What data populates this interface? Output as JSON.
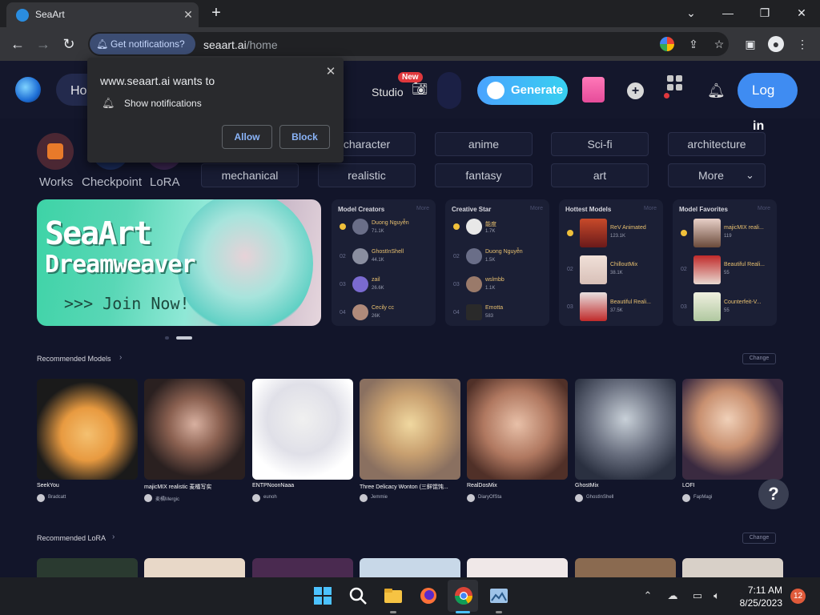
{
  "browser": {
    "tab_title": "SeaArt",
    "tab_close": "✕",
    "new_tab": "+",
    "window_controls": [
      "⌄",
      "—",
      "❐",
      "✕"
    ],
    "notif_chip": "Get notifications?",
    "url_host": "seaart.ai",
    "url_path": "/home"
  },
  "popup": {
    "title": "www.seaart.ai wants to",
    "permission": "Show notifications",
    "allow": "Allow",
    "block": "Block",
    "close": "✕"
  },
  "header": {
    "home_label": "Ho",
    "studio_label": "Studio",
    "new_badge": "New",
    "generate_label": "Generate",
    "login_label": "Log",
    "login_label_wrap": "in"
  },
  "categories": {
    "works": "Works",
    "checkpoint": "Checkpoint",
    "lora": "LoRA"
  },
  "tags": {
    "row1": [
      "character",
      "anime",
      "Sci-fi",
      "architecture"
    ],
    "row2": [
      "mechanical",
      "realistic",
      "fantasy",
      "art"
    ],
    "more": "More"
  },
  "banner": {
    "line1": "SeaArt",
    "line2": "Dreamweaver",
    "cta": ">>> Join Now!"
  },
  "panels": [
    {
      "title": "Model Creators",
      "more": "More",
      "items": [
        {
          "rank": "",
          "name": "Duong Nguyễn",
          "value": "71.1K"
        },
        {
          "rank": "02",
          "name": "GhostInShell",
          "value": "44.1K"
        },
        {
          "rank": "03",
          "name": "zail",
          "value": "26.6K"
        },
        {
          "rank": "04",
          "name": "Cecily cc",
          "value": "26K"
        }
      ]
    },
    {
      "title": "Creative Star",
      "more": "More",
      "items": [
        {
          "rank": "",
          "name": "能度",
          "value": "1.7K"
        },
        {
          "rank": "02",
          "name": "Duong Nguyễn",
          "value": "1.5K"
        },
        {
          "rank": "03",
          "name": "wslmbb",
          "value": "1.1K"
        },
        {
          "rank": "04",
          "name": "Emotta",
          "value": "583"
        }
      ]
    },
    {
      "title": "Hottest Models",
      "more": "More",
      "items": [
        {
          "rank": "",
          "name": "ReV Animated",
          "value": "123.1K"
        },
        {
          "rank": "02",
          "name": "ChilloutMix",
          "value": "38.1K"
        },
        {
          "rank": "03",
          "name": "Beautiful Reali...",
          "value": "37.5K"
        }
      ]
    },
    {
      "title": "Model Favorites",
      "more": "More",
      "items": [
        {
          "rank": "",
          "name": "majicMIX reali...",
          "value": "119"
        },
        {
          "rank": "02",
          "name": "Beautiful Reali...",
          "value": "55"
        },
        {
          "rank": "03",
          "name": "Counterfeit-V...",
          "value": "55"
        }
      ]
    }
  ],
  "recommended_models": {
    "title": "Recommended Models",
    "change": "Change",
    "cards": [
      {
        "name": "SeekYou",
        "user": "Bradcatt"
      },
      {
        "name": "majicMIX realistic 麦橘写实",
        "user": "麦橘Mergic"
      },
      {
        "name": "ENTPNoonNaaa",
        "user": "eunoh"
      },
      {
        "name": "Three Delicacy Wonton (三鲜馄饨...",
        "user": "Jemmie"
      },
      {
        "name": "RealDosMix",
        "user": "DiaryOfSta"
      },
      {
        "name": "GhostMix",
        "user": "GhostInShell"
      },
      {
        "name": "LOFI",
        "user": "FapMagi"
      }
    ]
  },
  "recommended_lora": {
    "title": "Recommended LoRA",
    "change": "Change"
  },
  "help": "?",
  "taskbar": {
    "time": "7:11 AM",
    "date": "8/25/2023",
    "notif_count": "12"
  }
}
